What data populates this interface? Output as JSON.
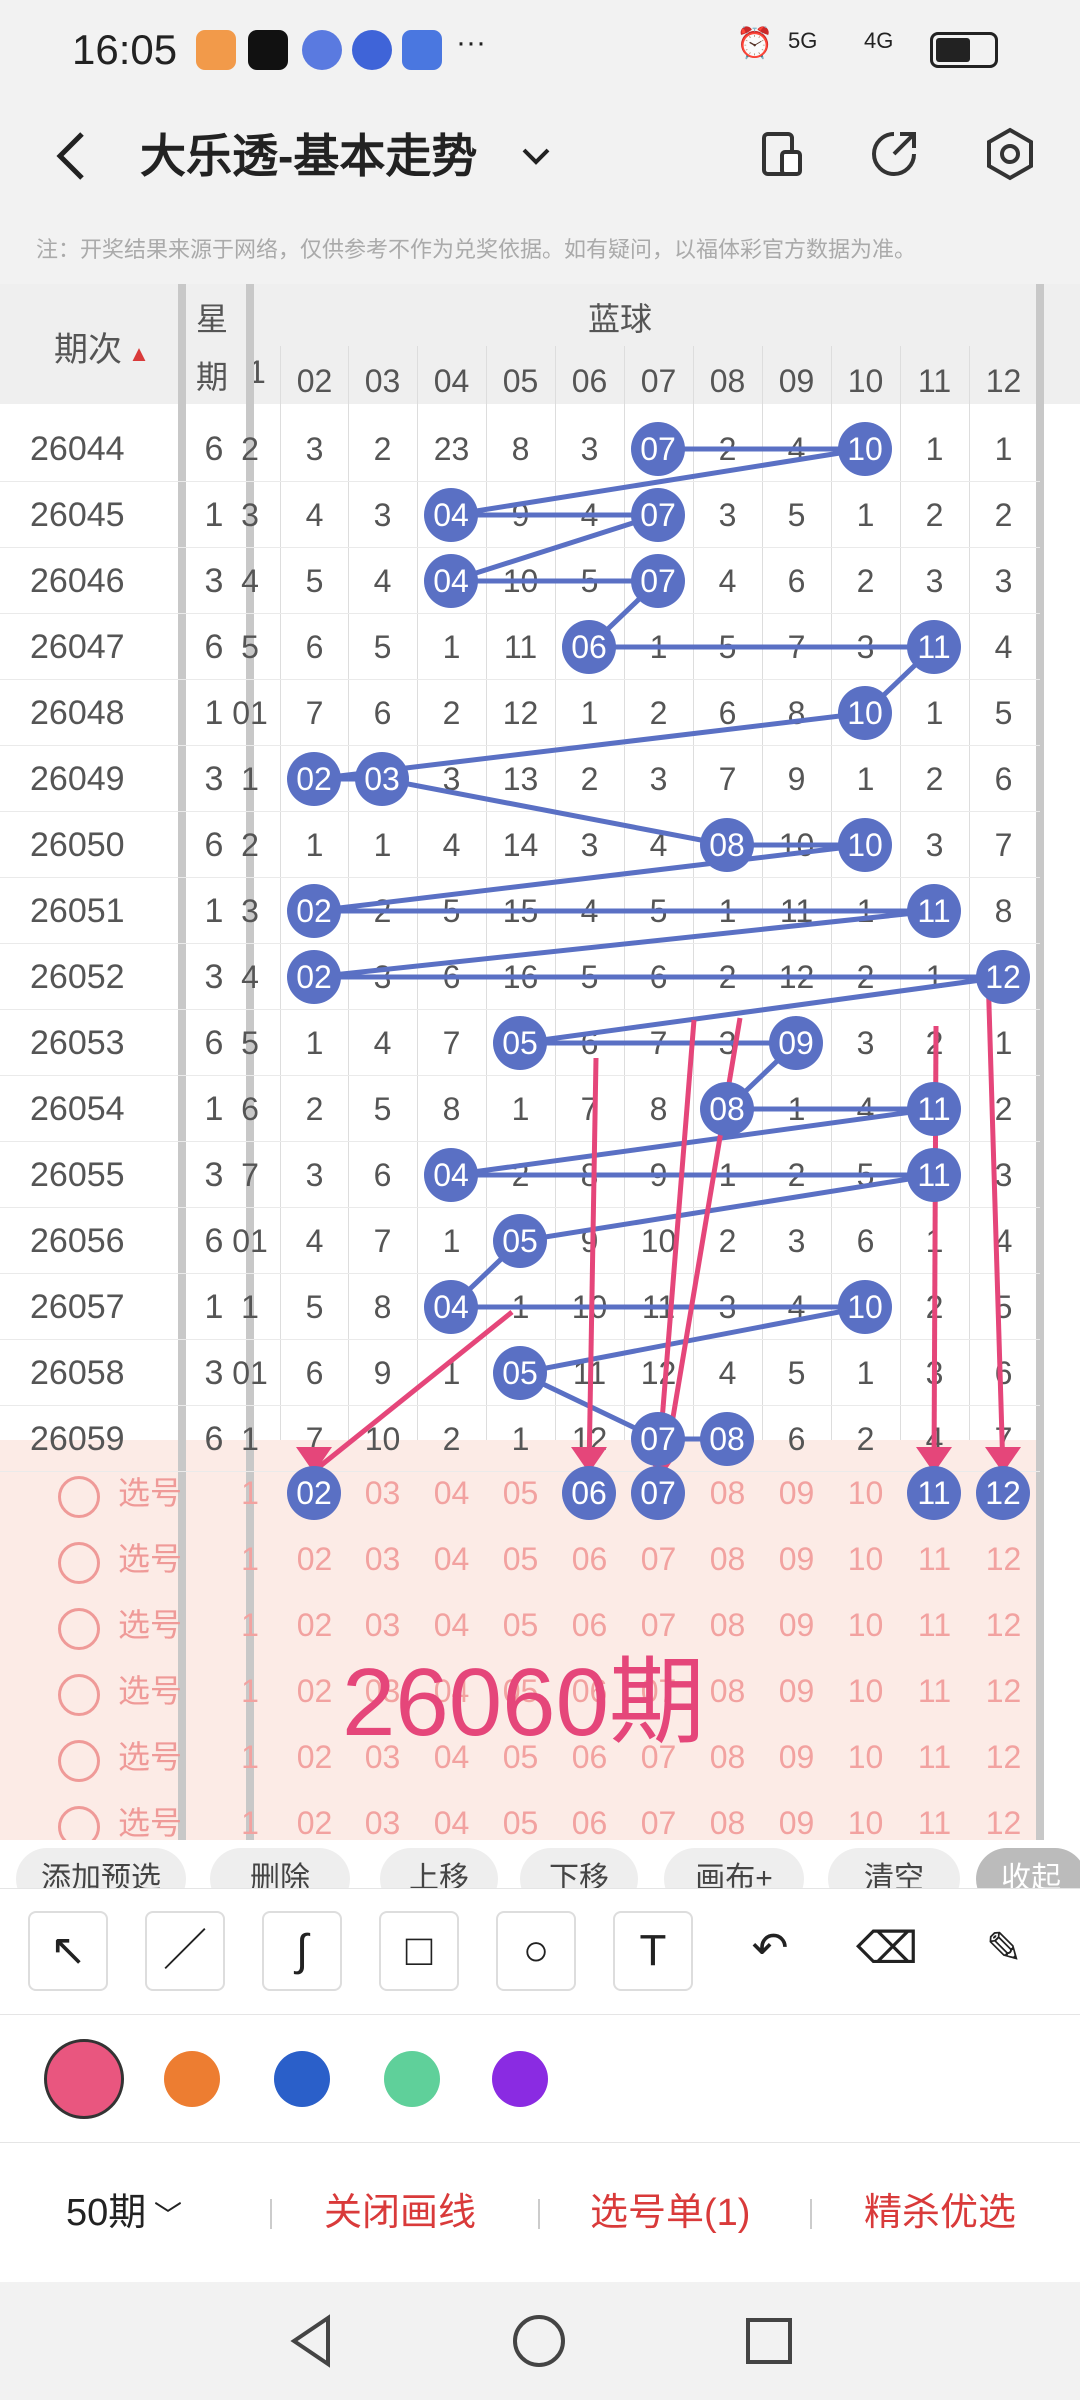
{
  "status": {
    "time": "16:05",
    "signal_5g": "5G",
    "signal_4g": "4G"
  },
  "title": "大乐透-基本走势",
  "notice": "注：开奖结果来源于网络，仅供参考不作为兑奖依据。如有疑问，以福体彩官方数据为准。",
  "table": {
    "issue_header": "期次",
    "week_header": [
      "星",
      "期"
    ],
    "blue_header": "蓝球",
    "partial_col": "1",
    "columns": [
      "02",
      "03",
      "04",
      "05",
      "06",
      "07",
      "08",
      "09",
      "10",
      "11",
      "12"
    ],
    "rows": [
      {
        "issue": "26044",
        "week": "6",
        "partial": "2",
        "cells": [
          "3",
          "2",
          "23",
          "8",
          "3",
          "07",
          "2",
          "4",
          "10",
          "1",
          "1"
        ]
      },
      {
        "issue": "26045",
        "week": "1",
        "partial": "3",
        "cells": [
          "4",
          "3",
          "04",
          "9",
          "4",
          "07",
          "3",
          "5",
          "1",
          "2",
          "2"
        ]
      },
      {
        "issue": "26046",
        "week": "3",
        "partial": "4",
        "cells": [
          "5",
          "4",
          "04",
          "10",
          "5",
          "07",
          "4",
          "6",
          "2",
          "3",
          "3"
        ]
      },
      {
        "issue": "26047",
        "week": "6",
        "partial": "5",
        "cells": [
          "6",
          "5",
          "1",
          "11",
          "06",
          "1",
          "5",
          "7",
          "3",
          "11",
          "4"
        ]
      },
      {
        "issue": "26048",
        "week": "1",
        "partial": "01",
        "cells": [
          "7",
          "6",
          "2",
          "12",
          "1",
          "2",
          "6",
          "8",
          "10",
          "1",
          "5"
        ]
      },
      {
        "issue": "26049",
        "week": "3",
        "partial": "1",
        "cells": [
          "02",
          "03",
          "3",
          "13",
          "2",
          "3",
          "7",
          "9",
          "1",
          "2",
          "6"
        ]
      },
      {
        "issue": "26050",
        "week": "6",
        "partial": "2",
        "cells": [
          "1",
          "1",
          "4",
          "14",
          "3",
          "4",
          "08",
          "10",
          "10",
          "3",
          "7"
        ]
      },
      {
        "issue": "26051",
        "week": "1",
        "partial": "3",
        "cells": [
          "02",
          "2",
          "5",
          "15",
          "4",
          "5",
          "1",
          "11",
          "1",
          "11",
          "8"
        ]
      },
      {
        "issue": "26052",
        "week": "3",
        "partial": "4",
        "cells": [
          "02",
          "3",
          "6",
          "16",
          "5",
          "6",
          "2",
          "12",
          "2",
          "1",
          "12"
        ]
      },
      {
        "issue": "26053",
        "week": "6",
        "partial": "5",
        "cells": [
          "1",
          "4",
          "7",
          "05",
          "6",
          "7",
          "3",
          "09",
          "3",
          "2",
          "1"
        ]
      },
      {
        "issue": "26054",
        "week": "1",
        "partial": "6",
        "cells": [
          "2",
          "5",
          "8",
          "1",
          "7",
          "8",
          "08",
          "1",
          "4",
          "11",
          "2"
        ]
      },
      {
        "issue": "26055",
        "week": "3",
        "partial": "7",
        "cells": [
          "3",
          "6",
          "04",
          "2",
          "8",
          "9",
          "1",
          "2",
          "5",
          "11",
          "3"
        ]
      },
      {
        "issue": "26056",
        "week": "6",
        "partial": "01",
        "cells": [
          "4",
          "7",
          "1",
          "05",
          "9",
          "10",
          "2",
          "3",
          "6",
          "1",
          "4"
        ]
      },
      {
        "issue": "26057",
        "week": "1",
        "partial": "1",
        "cells": [
          "5",
          "8",
          "04",
          "1",
          "10",
          "11",
          "3",
          "4",
          "10",
          "2",
          "5"
        ]
      },
      {
        "issue": "26058",
        "week": "3",
        "partial": "01",
        "cells": [
          "6",
          "9",
          "1",
          "05",
          "11",
          "12",
          "4",
          "5",
          "1",
          "3",
          "6"
        ]
      },
      {
        "issue": "26059",
        "week": "6",
        "partial": "1",
        "cells": [
          "7",
          "10",
          "2",
          "1",
          "12",
          "07",
          "08",
          "6",
          "2",
          "4",
          "7"
        ]
      }
    ],
    "pick_label": "选号",
    "pick_selected": [
      "02",
      "06",
      "07",
      "11",
      "12"
    ]
  },
  "annotation": {
    "text": "26060期",
    "color": "#e5467a"
  },
  "chips": [
    "添加预选",
    "删除",
    "上移",
    "下移",
    "画布+",
    "清空",
    "收起"
  ],
  "tools": [
    "arrow-tool-icon",
    "line-tool-icon",
    "curve-tool-icon",
    "rect-tool-icon",
    "circle-tool-icon",
    "text-tool-icon",
    "undo-icon",
    "eraser-icon",
    "brush-icon"
  ],
  "tool_glyphs": [
    "↖",
    "／",
    "∫",
    "□",
    "○",
    "T",
    "↶",
    "⌫",
    "✎"
  ],
  "colors": [
    "#e9567f",
    "#ed7d31",
    "#2a5fc9",
    "#5fd09a",
    "#8a2be2"
  ],
  "bottom": {
    "periods": "50期",
    "close_lines": "关闭画线",
    "pick_list": "选号单(1)",
    "best": "精杀优选"
  },
  "accent": "#d93a3a",
  "ball_color": "#5a70c4"
}
